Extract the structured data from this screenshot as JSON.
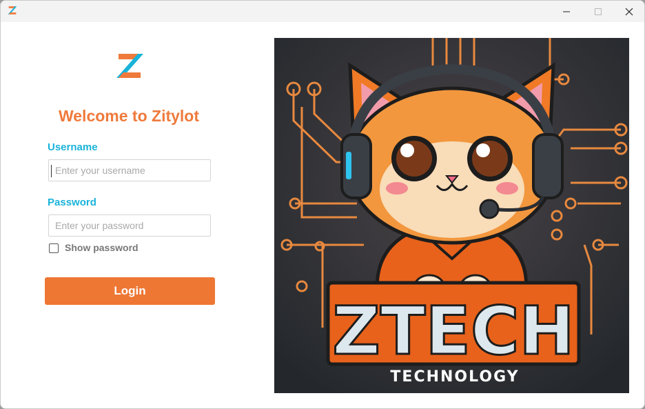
{
  "window": {
    "app_icon": "zitylot-z-logo",
    "controls": {
      "minimize": "minimize-icon",
      "maximize": "maximize-icon",
      "close": "close-icon"
    }
  },
  "login": {
    "logo": "zitylot-z-logo",
    "title": "Welcome to Zitylot",
    "username_label": "Username",
    "username_placeholder": "Enter your username",
    "username_value": "",
    "password_label": "Password",
    "password_placeholder": "Enter your password",
    "password_value": "",
    "show_password_label": "Show password",
    "show_password_checked": false,
    "login_button": "Login"
  },
  "artwork": {
    "brand": "ZTECH",
    "tagline": "TECHNOLOGY"
  },
  "colors": {
    "accent_orange": "#ee7734",
    "accent_cyan": "#1ab3d9",
    "title_orange": "#ef7a3c"
  }
}
